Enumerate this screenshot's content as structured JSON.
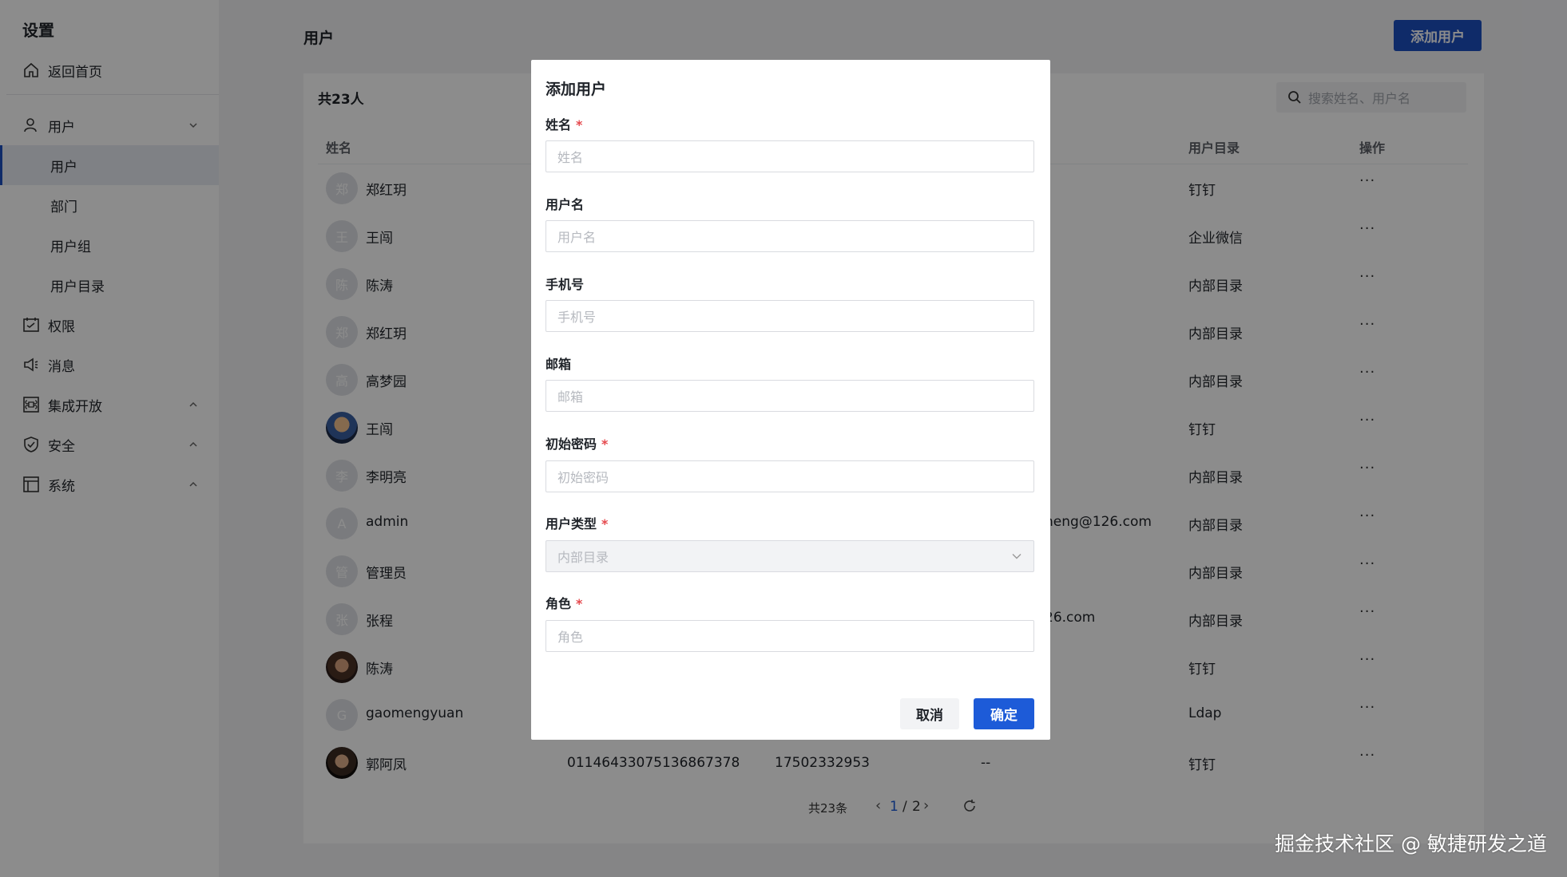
{
  "sidebar": {
    "title": "设置",
    "home": "返回首页",
    "users_group": "用户",
    "sub": [
      "用户",
      "部门",
      "用户组",
      "用户目录"
    ],
    "items": [
      "权限",
      "消息",
      "集成开放",
      "安全",
      "系统"
    ]
  },
  "header": {
    "title": "用户",
    "add_button": "添加用户"
  },
  "list": {
    "count": "共23人",
    "search_placeholder": "搜索姓名、用户名",
    "columns": {
      "name": "姓名",
      "directory": "用户目录",
      "actions": "操作"
    },
    "rows": [
      {
        "initial": "郑",
        "name": "郑红玥",
        "extra": "",
        "dir": "钉钉",
        "op": "···"
      },
      {
        "initial": "王",
        "name": "王闯",
        "extra": "",
        "dir": "企业微信",
        "op": "···"
      },
      {
        "initial": "陈",
        "name": "陈涛",
        "extra": "",
        "dir": "内部目录",
        "op": "···"
      },
      {
        "initial": "郑",
        "name": "郑红玥",
        "extra": "",
        "dir": "内部目录",
        "op": "···"
      },
      {
        "initial": "高",
        "name": "高梦园",
        "extra": "",
        "dir": "内部目录",
        "op": "···"
      },
      {
        "initial": "",
        "name": "王闯",
        "extra": "",
        "dir": "钉钉",
        "op": "···"
      },
      {
        "initial": "李",
        "name": "李明亮",
        "extra": "",
        "dir": "内部目录",
        "op": "···"
      },
      {
        "initial": "A",
        "name": "admin",
        "extra": "neng@126.com",
        "dir": "内部目录",
        "op": "···"
      },
      {
        "initial": "管",
        "name": "管理员",
        "extra": "",
        "dir": "内部目录",
        "op": "···"
      },
      {
        "initial": "张",
        "name": "张程",
        "extra": "26.com",
        "dir": "内部目录",
        "op": "···"
      },
      {
        "initial": "",
        "name": "陈涛",
        "extra": "",
        "dir": "钉钉",
        "op": "···"
      },
      {
        "initial": "G",
        "name": "gaomengyuan",
        "extra": "",
        "dir": "Ldap",
        "op": "···"
      },
      {
        "initial": "",
        "name": "郭阿凤",
        "extra": "",
        "dir": "钉钉",
        "op": "···"
      }
    ],
    "last_row": {
      "username": "01146433075136867378",
      "phone": "17502332953",
      "email": "--"
    }
  },
  "pagination": {
    "total": "共23条",
    "current": "1",
    "separator": "/",
    "pages": "2"
  },
  "modal": {
    "title": "添加用户",
    "fields": [
      {
        "label": "姓名",
        "required": "*",
        "placeholder": "姓名"
      },
      {
        "label": "用户名",
        "required": "",
        "placeholder": "用户名"
      },
      {
        "label": "手机号",
        "required": "",
        "placeholder": "手机号"
      },
      {
        "label": "邮箱",
        "required": "",
        "placeholder": "邮箱"
      },
      {
        "label": "初始密码",
        "required": "*",
        "placeholder": "初始密码"
      },
      {
        "label": "用户类型",
        "required": "*",
        "placeholder": "内部目录"
      },
      {
        "label": "角色",
        "required": "*",
        "placeholder": "角色"
      }
    ],
    "cancel": "取消",
    "confirm": "确定"
  },
  "watermark": "掘金技术社区 @ 敏捷研发之道",
  "colors": {
    "primary": "#1d4fbf",
    "confirm": "#1d5bd8",
    "required": "#e5484d"
  }
}
